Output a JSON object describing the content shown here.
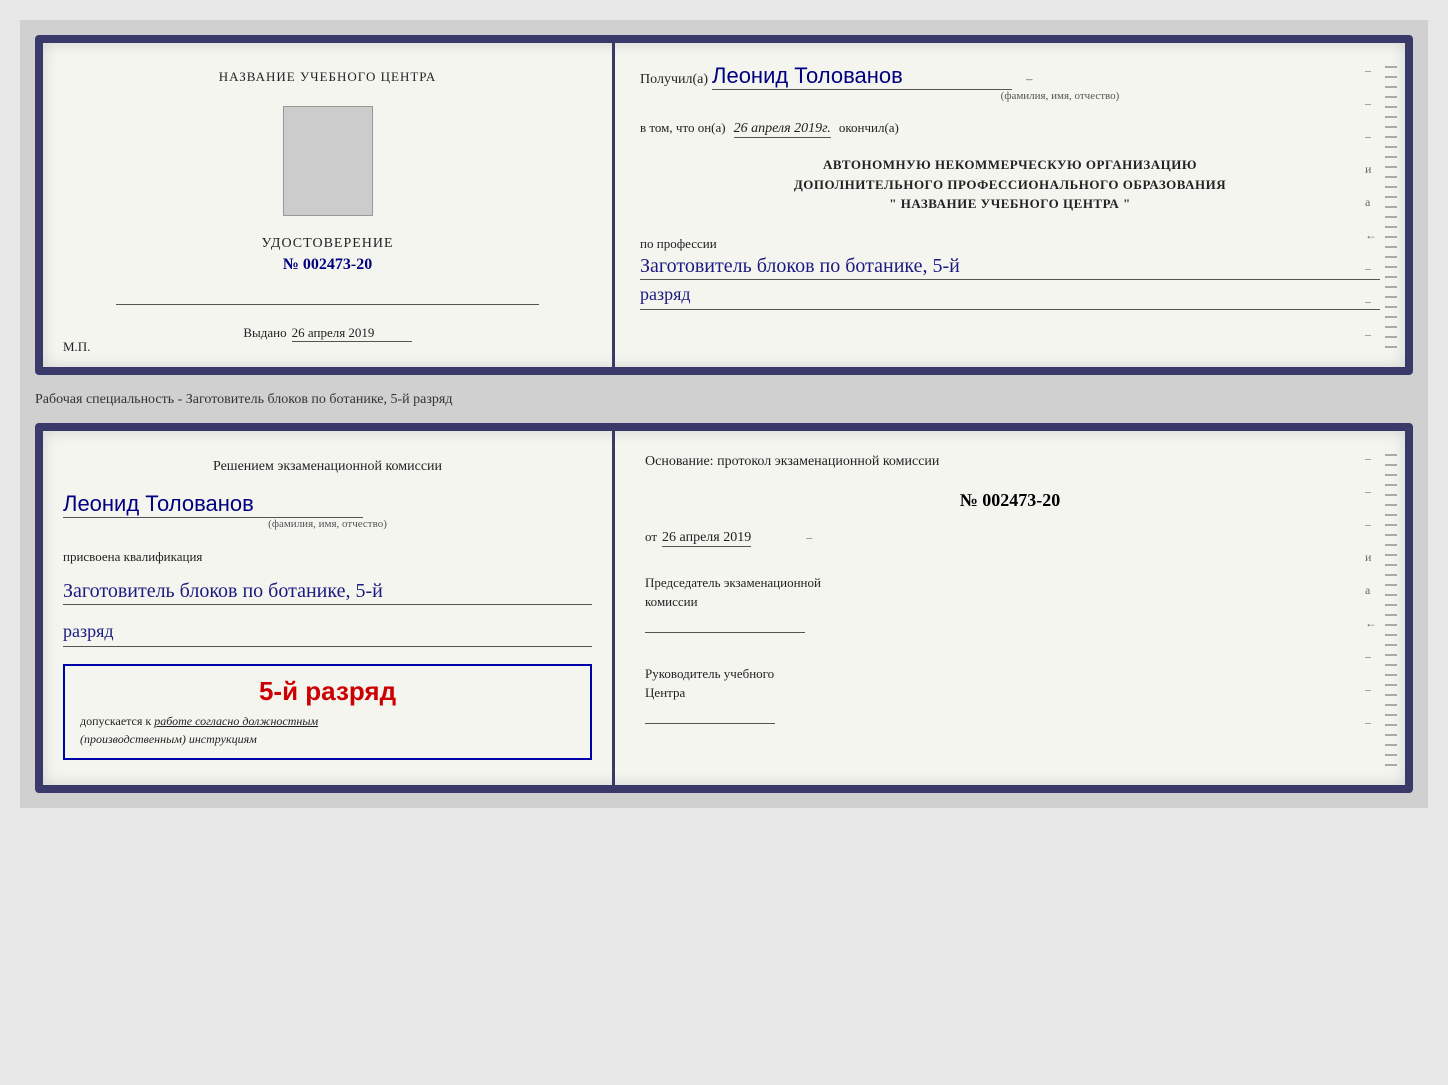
{
  "doc1": {
    "left": {
      "title": "НАЗВАНИЕ УЧЕБНОГО ЦЕНТРА",
      "cert_label": "УДОСТОВЕРЕНИЕ",
      "cert_number": "№ 002473-20",
      "issued_label": "Выдано",
      "issued_date": "26 апреля 2019",
      "mp_label": "М.П."
    },
    "right": {
      "received_label": "Получил(а)",
      "recipient_name": "Леонид Толованов",
      "fio_subtitle": "(фамилия, имя, отчество)",
      "in_that_label": "в том, что он(а)",
      "completion_date": "26 апреля 2019г.",
      "finished_label": "окончил(а)",
      "org_line1": "АВТОНОМНУЮ НЕКОММЕРЧЕСКУЮ ОРГАНИЗАЦИЮ",
      "org_line2": "ДОПОЛНИТЕЛЬНОГО ПРОФЕССИОНАЛЬНОГО ОБРАЗОВАНИЯ",
      "org_line3": "\"   НАЗВАНИЕ УЧЕБНОГО ЦЕНТРА   \"",
      "profession_label": "по профессии",
      "profession_value": "Заготовитель блоков по ботанике, 5-й",
      "rank_value": "разряд",
      "dash1": "–",
      "dash2": "–",
      "dash3": "–",
      "dash4": "и",
      "dash5": "а",
      "dash6": "←",
      "dash7": "–",
      "dash8": "–",
      "dash9": "–"
    }
  },
  "separator": {
    "text": "Рабочая специальность - Заготовитель блоков по ботанике, 5-й разряд"
  },
  "doc2": {
    "left": {
      "commission_text1": "Решением экзаменационной комиссии",
      "recipient_name": "Леонид Толованов",
      "fio_subtitle": "(фамилия, имя, отчество)",
      "qualification_label": "присвоена квалификация",
      "qualification_value": "Заготовитель блоков по ботанике, 5-й",
      "rank_value": "разряд",
      "stamp_rank": "5-й разряд",
      "stamp_line1": "допускается к",
      "stamp_underline": "работе согласно должностным",
      "stamp_line2": "(производственным) инструкциям"
    },
    "right": {
      "basis_text": "Основание: протокол экзаменационной комиссии",
      "protocol_number": "№  002473-20",
      "date_prefix": "от",
      "date_value": "26 апреля 2019",
      "chairman_line1": "Председатель экзаменационной",
      "chairman_line2": "комиссии",
      "director_line1": "Руководитель учебного",
      "director_line2": "Центра",
      "dash1": "–",
      "dash2": "–",
      "dash3": "–",
      "dash4": "и",
      "dash5": "а",
      "dash6": "←",
      "dash7": "–",
      "dash8": "–",
      "dash9": "–"
    }
  }
}
